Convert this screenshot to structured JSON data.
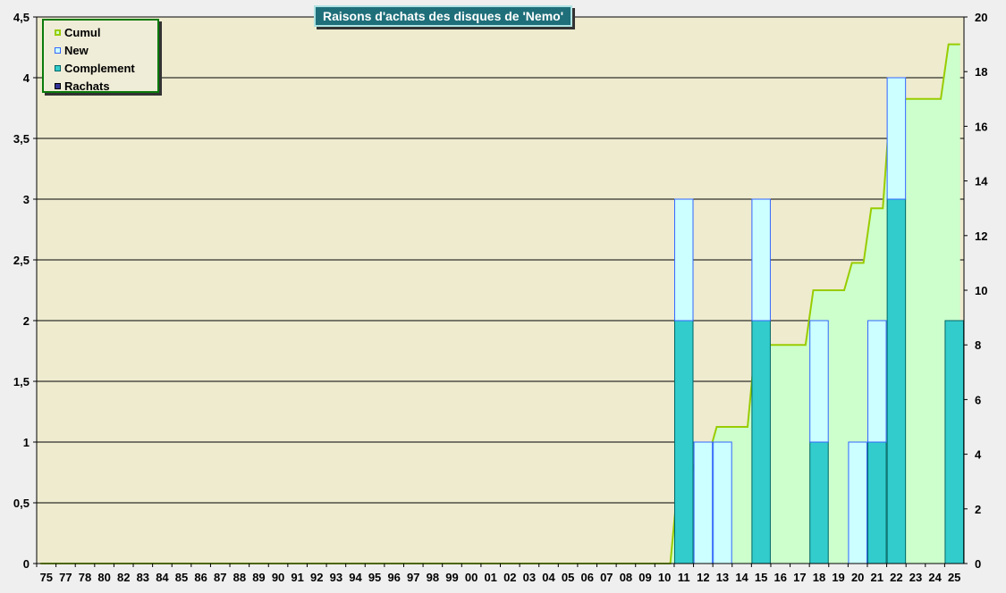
{
  "chart_data": {
    "type": "bar",
    "title": "Raisons d'achats des disques de 'Nemo'",
    "categories": [
      "75",
      "77",
      "78",
      "80",
      "82",
      "83",
      "84",
      "85",
      "86",
      "87",
      "88",
      "89",
      "90",
      "91",
      "92",
      "93",
      "94",
      "95",
      "96",
      "97",
      "98",
      "99",
      "00",
      "01",
      "02",
      "03",
      "04",
      "05",
      "06",
      "07",
      "08",
      "09",
      "10",
      "11",
      "12",
      "13",
      "14",
      "15",
      "16",
      "17",
      "18",
      "19",
      "20",
      "21",
      "22",
      "23",
      "24",
      "25"
    ],
    "series": [
      {
        "name": "Complement",
        "axis": "left",
        "color": "#33cccc",
        "values": [
          0,
          0,
          0,
          0,
          0,
          0,
          0,
          0,
          0,
          0,
          0,
          0,
          0,
          0,
          0,
          0,
          0,
          0,
          0,
          0,
          0,
          0,
          0,
          0,
          0,
          0,
          0,
          0,
          0,
          0,
          0,
          0,
          0,
          2,
          0,
          0,
          0,
          2,
          0,
          0,
          1,
          0,
          0,
          1,
          3,
          0,
          0,
          2
        ]
      },
      {
        "name": "New",
        "axis": "left",
        "color": "#ccffff",
        "values": [
          0,
          0,
          0,
          0,
          0,
          0,
          0,
          0,
          0,
          0,
          0,
          0,
          0,
          0,
          0,
          0,
          0,
          0,
          0,
          0,
          0,
          0,
          0,
          0,
          0,
          0,
          0,
          0,
          0,
          0,
          0,
          0,
          0,
          1,
          1,
          1,
          0,
          1,
          0,
          0,
          1,
          0,
          1,
          1,
          1,
          0,
          0,
          0
        ]
      },
      {
        "name": "Rachats",
        "axis": "left",
        "color": "#333399",
        "values": [
          0,
          0,
          0,
          0,
          0,
          0,
          0,
          0,
          0,
          0,
          0,
          0,
          0,
          0,
          0,
          0,
          0,
          0,
          0,
          0,
          0,
          0,
          0,
          0,
          0,
          0,
          0,
          0,
          0,
          0,
          0,
          0,
          0,
          0,
          0,
          0,
          0,
          0,
          0,
          0,
          0,
          0,
          0,
          0,
          0,
          0,
          0,
          0
        ]
      },
      {
        "name": "Cumul",
        "axis": "right",
        "type": "area",
        "color": "#99cc00",
        "fill": "#ccffcc",
        "values": [
          0,
          0,
          0,
          0,
          0,
          0,
          0,
          0,
          0,
          0,
          0,
          0,
          0,
          0,
          0,
          0,
          0,
          0,
          0,
          0,
          0,
          0,
          0,
          0,
          0,
          0,
          0,
          0,
          0,
          0,
          0,
          0,
          0,
          3,
          4,
          5,
          5,
          8,
          8,
          8,
          10,
          10,
          11,
          13,
          17,
          17,
          17,
          19
        ]
      }
    ],
    "y_left": {
      "ylim": [
        0,
        4.5
      ],
      "ticks": [
        "0",
        "0,5",
        "1",
        "1,5",
        "2",
        "2,5",
        "3",
        "3,5",
        "4",
        "4,5"
      ]
    },
    "y_right": {
      "ylim": [
        0,
        20
      ],
      "ticks": [
        "0",
        "2",
        "4",
        "6",
        "8",
        "10",
        "12",
        "14",
        "16",
        "18",
        "20"
      ]
    },
    "grid": true,
    "legend_position": "top-left",
    "legend": [
      "Cumul",
      "New",
      "Complement",
      "Rachats"
    ],
    "colors": {
      "plot_bg": "#eeebcf",
      "page_bg": "#efefef",
      "gridline": "#000000",
      "title_bg": "#1f6f7a",
      "legend_border": "#0b7a0b"
    }
  }
}
